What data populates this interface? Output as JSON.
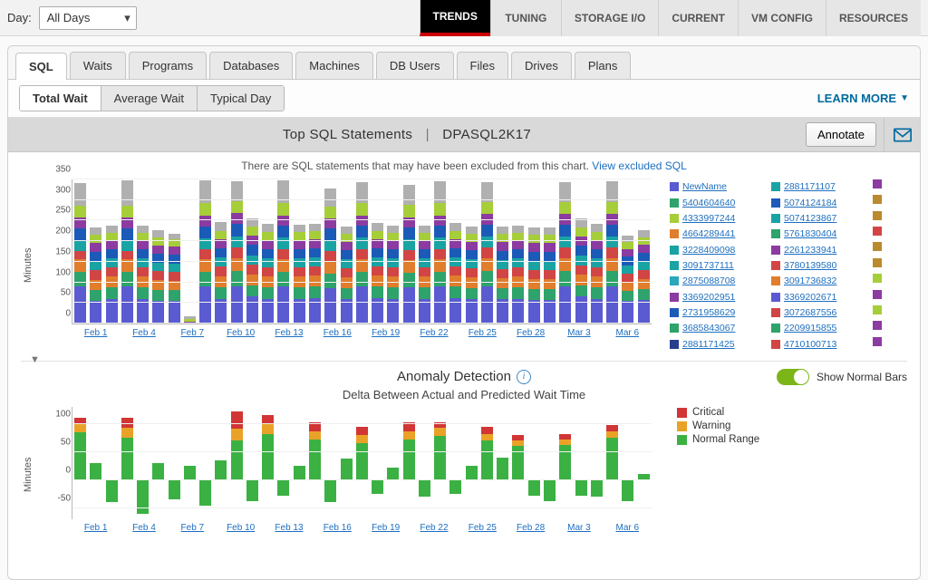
{
  "filters": {
    "day_label": "Day:",
    "day_value": "All Days"
  },
  "main_nav": {
    "items": [
      "TRENDS",
      "TUNING",
      "STORAGE I/O",
      "CURRENT",
      "VM CONFIG",
      "RESOURCES"
    ],
    "active": 0
  },
  "sub_nav": {
    "items": [
      "SQL",
      "Waits",
      "Programs",
      "Databases",
      "Machines",
      "DB Users",
      "Files",
      "Drives",
      "Plans"
    ],
    "active": 0
  },
  "wait_modes": {
    "items": [
      "Total Wait",
      "Average Wait",
      "Typical Day"
    ],
    "active": 0
  },
  "learn_more_label": "LEARN MORE",
  "page_title": {
    "left": "Top SQL Statements",
    "right": "DPASQL2K17"
  },
  "annotate_label": "Annotate",
  "excluded_note": {
    "text": "There are SQL statements that may have been excluded from this chart. ",
    "link": "View excluded SQL"
  },
  "chart_data": [
    {
      "id": "top_sql_wait",
      "type": "bar",
      "stacked": true,
      "ylabel": "Minutes",
      "y_ticks": [
        0,
        50,
        100,
        150,
        200,
        250,
        300,
        350
      ],
      "ylim": [
        0,
        350
      ],
      "x_labels": [
        "Feb 1",
        "Feb 4",
        "Feb 7",
        "Feb 10",
        "Feb 13",
        "Feb 16",
        "Feb 19",
        "Feb 22",
        "Feb 25",
        "Feb 28",
        "Mar 3",
        "Mar 6"
      ],
      "stack_colors": [
        "#5a5bd1",
        "#2ea36b",
        "#e07e2d",
        "#d24545",
        "#1aa3a3",
        "#1c5ab8",
        "#8c3ba0",
        "#a6ce39",
        "#b0b0b0"
      ],
      "legend_colors": {
        "NewName": "#5a5bd1",
        "5404604640": "#2ea36b",
        "4333997244": "#a6ce39",
        "4664289441": "#e07e2d",
        "3228409098": "#1aa3a3",
        "3091737111": "#1aa3a3",
        "2875088708": "#2aa7bd",
        "3369202951": "#8c3ba0",
        "2731958629": "#1c5ab8",
        "3685843067": "#2ea36b",
        "2881171425": "#28418e",
        "2881171107": "#1aa3a3",
        "5074124184": "#1c5ab8",
        "5074123867": "#1aa3a3",
        "5761830404": "#2ea36b",
        "2261233941": "#8c3ba0",
        "3780139580": "#d24545",
        "3091736832": "#e07e2d",
        "3369202671": "#5a5bd1",
        "3072687556": "#d24545",
        "2209915855": "#2ea36b",
        "4710100713": "#d24545"
      },
      "legend_col1": [
        "NewName",
        "5404604640",
        "4333997244",
        "4664289441",
        "3228409098",
        "3091737111",
        "2875088708",
        "3369202951",
        "2731958629",
        "3685843067",
        "2881171425"
      ],
      "legend_col2": [
        "2881171107",
        "5074124184",
        "5074123867",
        "5761830404",
        "2261233941",
        "3780139580",
        "3091736832",
        "3369202671",
        "3072687556",
        "2209915855",
        "4710100713"
      ],
      "legend_col3_colors": [
        "#8c3ba0",
        "#b98a2e",
        "#b98a2e",
        "#d24545",
        "#b98a2e",
        "#b98a2e",
        "#a6ce39",
        "#8c3ba0",
        "#a6ce39",
        "#8c3ba0",
        "#8c3ba0"
      ],
      "bars": [
        [
          90,
          35,
          30,
          20,
          25,
          30,
          25,
          30,
          55
        ],
        [
          55,
          25,
          25,
          25,
          22,
          22,
          20,
          20,
          18
        ],
        [
          60,
          28,
          25,
          22,
          22,
          22,
          20,
          20,
          18
        ],
        [
          90,
          35,
          30,
          20,
          25,
          30,
          25,
          30,
          60
        ],
        [
          60,
          28,
          25,
          22,
          22,
          22,
          20,
          20,
          18
        ],
        [
          55,
          25,
          25,
          22,
          20,
          22,
          20,
          18,
          18
        ],
        [
          55,
          25,
          22,
          22,
          20,
          22,
          20,
          18,
          12
        ],
        [
          0,
          0,
          0,
          0,
          0,
          0,
          5,
          5,
          8
        ],
        [
          90,
          35,
          30,
          25,
          25,
          30,
          25,
          30,
          55
        ],
        [
          60,
          28,
          25,
          25,
          22,
          22,
          22,
          20,
          22
        ],
        [
          90,
          38,
          30,
          25,
          28,
          30,
          25,
          30,
          48
        ],
        [
          65,
          28,
          25,
          25,
          22,
          25,
          22,
          22,
          20
        ],
        [
          60,
          28,
          25,
          22,
          22,
          22,
          22,
          20,
          20
        ],
        [
          90,
          35,
          30,
          25,
          28,
          28,
          25,
          30,
          55
        ],
        [
          60,
          28,
          25,
          22,
          22,
          22,
          22,
          20,
          18
        ],
        [
          62,
          28,
          25,
          22,
          22,
          22,
          22,
          20,
          18
        ],
        [
          85,
          35,
          30,
          25,
          26,
          28,
          25,
          28,
          45
        ],
        [
          60,
          26,
          25,
          22,
          22,
          22,
          20,
          20,
          18
        ],
        [
          90,
          35,
          30,
          25,
          28,
          28,
          25,
          30,
          50
        ],
        [
          62,
          28,
          25,
          22,
          22,
          22,
          22,
          20,
          20
        ],
        [
          60,
          28,
          25,
          22,
          22,
          22,
          20,
          20,
          18
        ],
        [
          88,
          35,
          30,
          25,
          26,
          28,
          25,
          30,
          48
        ],
        [
          60,
          28,
          25,
          22,
          22,
          22,
          20,
          20,
          18
        ],
        [
          90,
          35,
          30,
          25,
          28,
          28,
          25,
          30,
          52
        ],
        [
          62,
          28,
          25,
          22,
          22,
          22,
          22,
          20,
          20
        ],
        [
          60,
          26,
          25,
          22,
          22,
          22,
          20,
          20,
          18
        ],
        [
          90,
          38,
          30,
          25,
          28,
          28,
          25,
          30,
          48
        ],
        [
          60,
          26,
          24,
          22,
          22,
          22,
          20,
          20,
          18
        ],
        [
          60,
          28,
          25,
          22,
          22,
          22,
          20,
          20,
          18
        ],
        [
          58,
          26,
          24,
          22,
          22,
          22,
          20,
          20,
          18
        ],
        [
          58,
          26,
          24,
          22,
          22,
          22,
          20,
          20,
          18
        ],
        [
          90,
          38,
          30,
          25,
          28,
          28,
          25,
          30,
          48
        ],
        [
          65,
          28,
          25,
          22,
          24,
          24,
          22,
          22,
          22
        ],
        [
          60,
          28,
          25,
          22,
          22,
          22,
          22,
          20,
          20
        ],
        [
          90,
          38,
          30,
          25,
          28,
          28,
          25,
          30,
          50
        ],
        [
          55,
          24,
          22,
          20,
          20,
          20,
          18,
          18,
          16
        ],
        [
          58,
          26,
          24,
          22,
          20,
          20,
          20,
          18,
          18
        ]
      ]
    },
    {
      "id": "anomaly",
      "type": "bar",
      "stacked": true,
      "title": "Anomaly Detection",
      "subtitle": "Delta Between Actual and Predicted Wait Time",
      "ylabel": "Minutes",
      "y_ticks": [
        -50,
        0,
        50,
        100
      ],
      "ylim": [
        -70,
        130
      ],
      "x_labels": [
        "Feb 1",
        "Feb 4",
        "Feb 7",
        "Feb 10",
        "Feb 13",
        "Feb 16",
        "Feb 19",
        "Feb 22",
        "Feb 25",
        "Feb 28",
        "Mar 3",
        "Mar 6"
      ],
      "legend": [
        {
          "label": "Critical",
          "color": "#d13535"
        },
        {
          "label": "Warning",
          "color": "#e9a227"
        },
        {
          "label": "Normal Range",
          "color": "#3bb143"
        }
      ],
      "toggle_label": "Show Normal Bars",
      "bars": [
        {
          "n": 85,
          "w": 15,
          "c": 10
        },
        {
          "n": 30
        },
        {
          "n": -40
        },
        {
          "n": 75,
          "w": 18,
          "c": 18
        },
        {
          "n": -60
        },
        {
          "n": 30
        },
        {
          "n": -35
        },
        {
          "n": 25
        },
        {
          "n": -45
        },
        {
          "n": 35
        },
        {
          "n": 70,
          "w": 22,
          "c": 30
        },
        {
          "n": -38
        },
        {
          "n": 82,
          "w": 18,
          "c": 15
        },
        {
          "n": -28
        },
        {
          "n": 25
        },
        {
          "n": 72,
          "w": 15,
          "c": 15
        },
        {
          "n": -40
        },
        {
          "n": 38
        },
        {
          "n": 65,
          "w": 15,
          "c": 15
        },
        {
          "n": -25
        },
        {
          "n": 22
        },
        {
          "n": 72,
          "w": 15,
          "c": 15
        },
        {
          "n": -30
        },
        {
          "n": 78,
          "w": 15,
          "c": 10
        },
        {
          "n": -25
        },
        {
          "n": 25
        },
        {
          "n": 70,
          "w": 12,
          "c": 12
        },
        {
          "n": 40
        },
        {
          "n": 60,
          "w": 10,
          "c": 10
        },
        {
          "n": -28
        },
        {
          "n": -38
        },
        {
          "n": 62,
          "w": 10,
          "c": 10
        },
        {
          "n": -28
        },
        {
          "n": -30
        },
        {
          "n": 75,
          "w": 12,
          "c": 10
        },
        {
          "n": -38
        },
        {
          "n": 10
        }
      ]
    }
  ]
}
